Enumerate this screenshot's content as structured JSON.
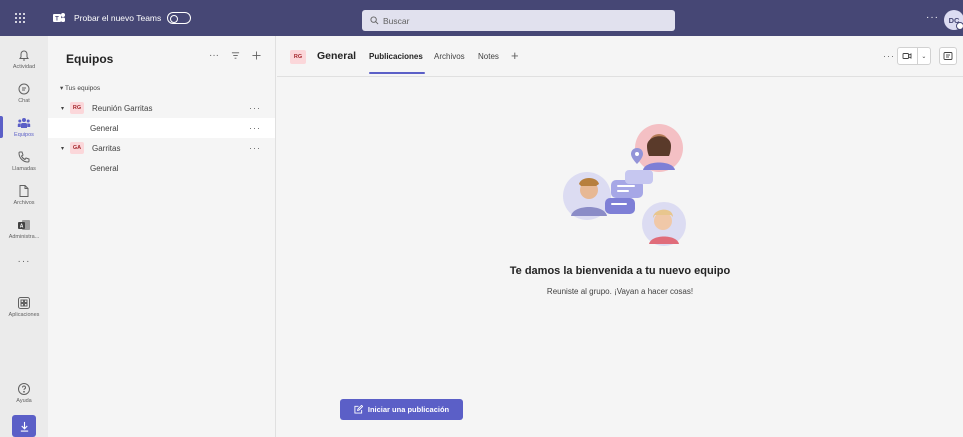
{
  "topbar": {
    "try_teams_label": "Probar el nuevo Teams",
    "search_placeholder": "Buscar",
    "more_label": "···",
    "avatar_initials": "DC"
  },
  "rail": {
    "items": [
      {
        "label": "Actividad",
        "icon": "bell-icon"
      },
      {
        "label": "Chat",
        "icon": "chat-icon"
      },
      {
        "label": "Equipos",
        "icon": "teams-icon",
        "active": true
      },
      {
        "label": "Llamadas",
        "icon": "phone-icon"
      },
      {
        "label": "Archivos",
        "icon": "file-icon"
      },
      {
        "label": "Administra...",
        "icon": "admin-app-icon"
      },
      {
        "label": "Aplicaciones",
        "icon": "apps-icon"
      },
      {
        "label": "Ayuda",
        "icon": "help-icon"
      }
    ],
    "more_label": "···"
  },
  "panel": {
    "title": "Equipos",
    "more_label": "···",
    "section_label": "Tus equipos",
    "teams": [
      {
        "badge": "RG",
        "name": "Reunión Garritas",
        "more": "···",
        "channels": [
          {
            "name": "General",
            "more": "···",
            "selected": true
          }
        ]
      },
      {
        "badge": "GA",
        "name": "Garritas",
        "more": "···",
        "channels": [
          {
            "name": "General"
          }
        ]
      }
    ]
  },
  "channel": {
    "badge": "RG",
    "title": "General",
    "tabs": [
      "Publicaciones",
      "Archivos",
      "Notes"
    ],
    "active_tab": "Publicaciones",
    "more_label": "···"
  },
  "welcome": {
    "title": "Te damos la bienvenida a tu nuevo equipo",
    "subtitle": "Reuniste al grupo. ¡Vayan a hacer cosas!"
  },
  "actions": {
    "new_post_label": "Iniciar una publicación"
  },
  "colors": {
    "topbar": "#464775",
    "accent": "#5b5fc7",
    "team_badge_bg": "#fbd7da",
    "team_badge_fg": "#a4262c"
  }
}
